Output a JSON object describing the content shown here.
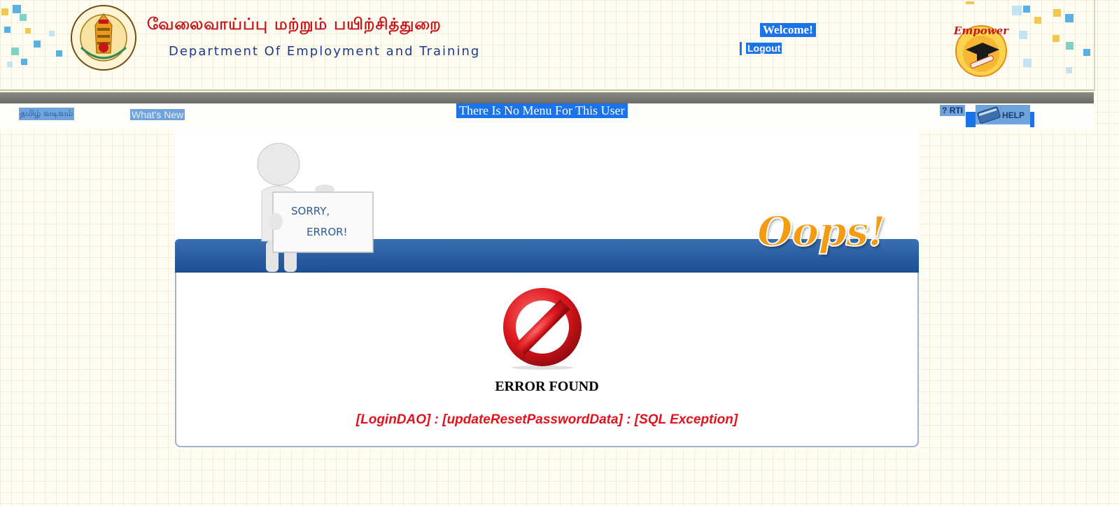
{
  "header": {
    "title_tamil": "வேலைவாய்ப்பு மற்றும் பயிற்சித்துறை",
    "title_english": "Department Of Employment and Training",
    "welcome_text": "Welcome!",
    "logout_label": "Logout",
    "emblem_icon": "tamil-nadu-emblem-icon",
    "logo_icon": "empower-logo-icon",
    "logo_text": "Empower"
  },
  "nav": {
    "tamil_version_label": "தமிழ் வடிவம்",
    "whats_new_label": "What's New",
    "menu_message": "There Is No Menu For This User",
    "rti_label": "RTI",
    "help_label": "HELP"
  },
  "error_page": {
    "sign_line1": "SORRY,",
    "sign_line2": "ERROR!",
    "oops_text": "Oops!",
    "heading": "ERROR FOUND",
    "message": "[LoginDAO] : [updateResetPasswordData] : [SQL Exception]"
  },
  "colors": {
    "accent_blue": "#1a73e8",
    "title_red": "#c8141c",
    "title_navy": "#1b3a8f",
    "error_red": "#e0131f",
    "banner_blue": "#1c4f93",
    "oops_orange": "#f39c12"
  }
}
